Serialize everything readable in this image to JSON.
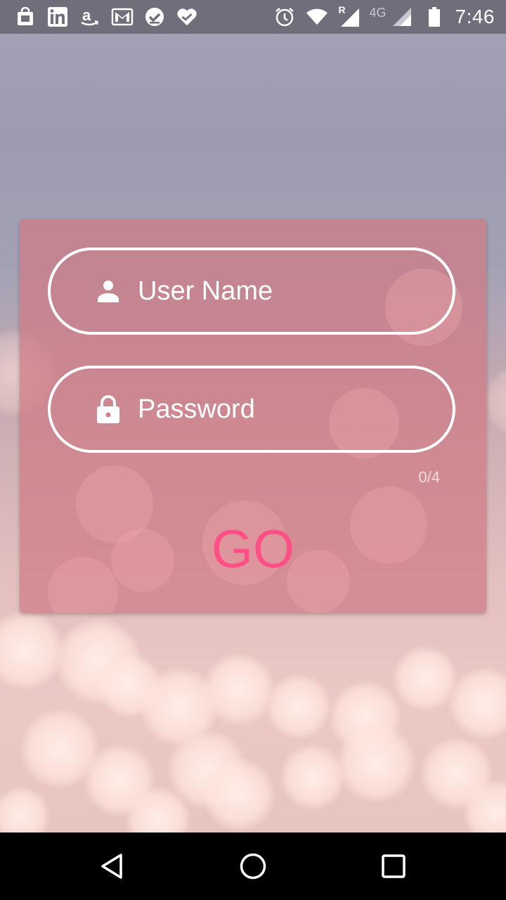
{
  "status_bar": {
    "time": "7:46",
    "network_label": "4G",
    "roaming_label": "R",
    "notification_icons": [
      "shopping-bag-icon",
      "linkedin-icon",
      "amazon-icon",
      "gmail-icon",
      "check-circle-icon",
      "heart-check-icon"
    ],
    "system_icons": [
      "alarm-icon",
      "wifi-icon",
      "signal-roaming-icon",
      "signal-icon",
      "battery-icon"
    ]
  },
  "login": {
    "username_placeholder": "User Name",
    "password_placeholder": "Password",
    "password_counter": "0/4",
    "go_label": "GO"
  },
  "colors": {
    "accent": "#ff4f86",
    "card_tint": "#ce7a84",
    "status_bar": "#6f6e7a",
    "nav_bar": "#000000"
  },
  "nav_bar": {
    "buttons": [
      "back-icon",
      "home-icon",
      "recents-icon"
    ]
  }
}
